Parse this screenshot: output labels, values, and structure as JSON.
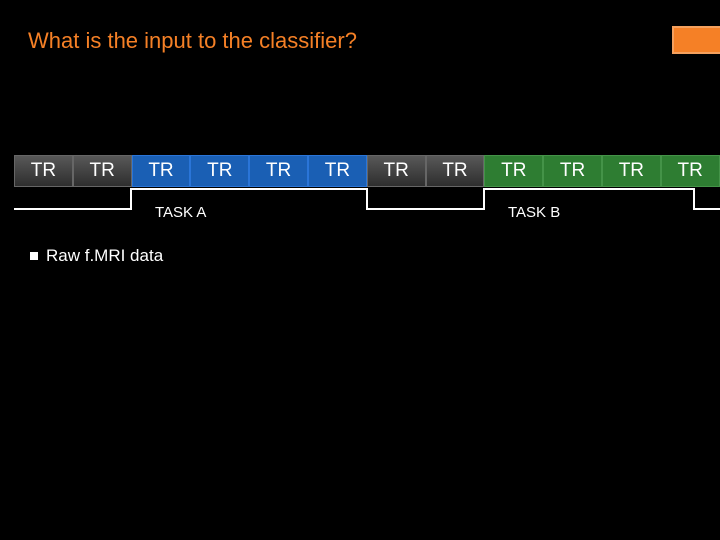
{
  "title": "What is the input to the classifier?",
  "tr_label": "TR",
  "tr_cells": [
    {
      "type": "rest"
    },
    {
      "type": "rest"
    },
    {
      "type": "blue"
    },
    {
      "type": "blue"
    },
    {
      "type": "blue"
    },
    {
      "type": "blue"
    },
    {
      "type": "rest"
    },
    {
      "type": "rest"
    },
    {
      "type": "green"
    },
    {
      "type": "green"
    },
    {
      "type": "green"
    },
    {
      "type": "green"
    }
  ],
  "task_a_label": "TASK A",
  "task_b_label": "TASK B",
  "bullet_text": "Raw f.MRI data"
}
